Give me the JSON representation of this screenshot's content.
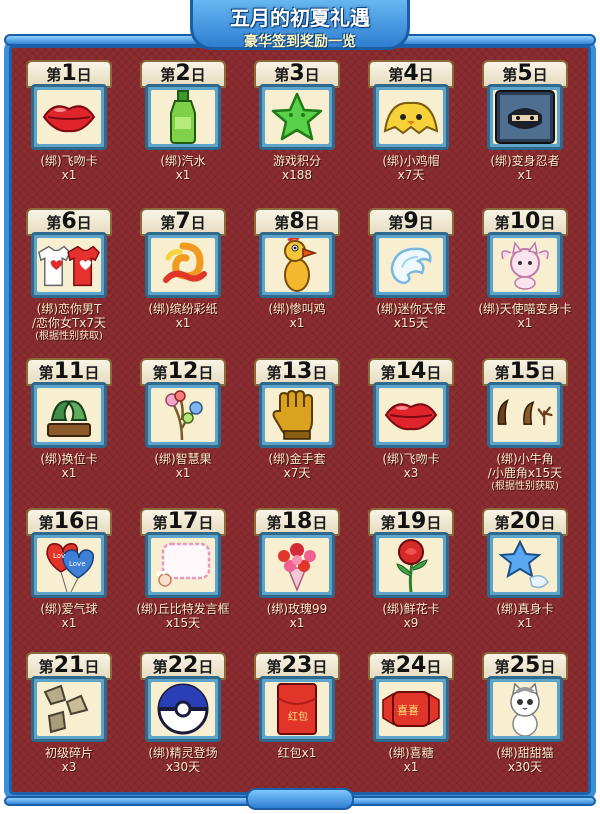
{
  "header": {
    "title": "五月的初夏礼遇",
    "subtitle": "豪华签到奖励一览"
  },
  "day_prefix": "第",
  "day_suffix": "日",
  "rewards": [
    {
      "day": "1",
      "icon": "lips-icon",
      "l1": "(绑)飞吻卡",
      "l2": "x1",
      "l3": ""
    },
    {
      "day": "2",
      "icon": "soda-bottle-icon",
      "l1": "(绑)汽水",
      "l2": "x1",
      "l3": ""
    },
    {
      "day": "3",
      "icon": "star-icon",
      "l1": "游戏积分",
      "l2": "x188",
      "l3": ""
    },
    {
      "day": "4",
      "icon": "chick-hat-icon",
      "l1": "(绑)小鸡帽",
      "l2": "x7天",
      "l3": ""
    },
    {
      "day": "5",
      "icon": "ninja-card-icon",
      "l1": "(绑)变身忍者",
      "l2": "x1",
      "l3": ""
    },
    {
      "day": "6",
      "icon": "tshirt-icon",
      "l1": "(绑)恋你男T",
      "l2": "/恋你女Tx7天",
      "l3": "(根据性别获取)"
    },
    {
      "day": "7",
      "icon": "confetti-icon",
      "l1": "(绑)缤纷彩纸",
      "l2": "x1",
      "l3": ""
    },
    {
      "day": "8",
      "icon": "screaming-chicken-icon",
      "l1": "(绑)惨叫鸡",
      "l2": "x1",
      "l3": ""
    },
    {
      "day": "9",
      "icon": "angel-wing-icon",
      "l1": "(绑)迷你天使",
      "l2": "x15天",
      "l3": ""
    },
    {
      "day": "10",
      "icon": "angel-cat-icon",
      "l1": "(绑)天使喵变身卡",
      "l2": "x1",
      "l3": ""
    },
    {
      "day": "11",
      "icon": "swap-card-icon",
      "l1": "(绑)换位卡",
      "l2": "x1",
      "l3": ""
    },
    {
      "day": "12",
      "icon": "wisdom-fruit-icon",
      "l1": "(绑)智慧果",
      "l2": "x1",
      "l3": ""
    },
    {
      "day": "13",
      "icon": "gold-glove-icon",
      "l1": "(绑)金手套",
      "l2": "x7天",
      "l3": ""
    },
    {
      "day": "14",
      "icon": "lips-icon",
      "l1": "(绑)飞吻卡",
      "l2": "x3",
      "l3": ""
    },
    {
      "day": "15",
      "icon": "antlers-icon",
      "l1": "(绑)小牛角",
      "l2": "/小鹿角x15天",
      "l3": "(根据性别获取)"
    },
    {
      "day": "16",
      "icon": "love-balloon-icon",
      "l1": "(绑)爱气球",
      "l2": "x1",
      "l3": ""
    },
    {
      "day": "17",
      "icon": "cupid-frame-icon",
      "l1": "(绑)丘比特发言框",
      "l2": "x15天",
      "l3": ""
    },
    {
      "day": "18",
      "icon": "rose-bouquet-icon",
      "l1": "(绑)玫瑰99",
      "l2": "x1",
      "l3": ""
    },
    {
      "day": "19",
      "icon": "rose-icon",
      "l1": "(绑)鲜花卡",
      "l2": "x9",
      "l3": ""
    },
    {
      "day": "20",
      "icon": "true-body-card-icon",
      "l1": "(绑)真身卡",
      "l2": "x1",
      "l3": ""
    },
    {
      "day": "21",
      "icon": "fragment-icon",
      "l1": "初级碎片",
      "l2": "x3",
      "l3": ""
    },
    {
      "day": "22",
      "icon": "pokeball-icon",
      "l1": "(绑)精灵登场",
      "l2": "x30天",
      "l3": ""
    },
    {
      "day": "23",
      "icon": "red-envelope-icon",
      "l1": "红包x1",
      "l2": "",
      "l3": ""
    },
    {
      "day": "24",
      "icon": "wedding-candy-icon",
      "l1": "(绑)喜糖",
      "l2": "x1",
      "l3": ""
    },
    {
      "day": "25",
      "icon": "sweet-cat-icon",
      "l1": "(绑)甜甜猫",
      "l2": "x30天",
      "l3": ""
    }
  ],
  "icon_text": {
    "red_envelope": "红包",
    "wedding_candy": "喜喜",
    "balloon": "Love"
  },
  "colors": {
    "background": "#8b2d31",
    "frame": "#3b8fd8",
    "label_text": "#ffe9c8",
    "card_border": "#2d6a8e",
    "card_fill": "#f7efcf"
  }
}
